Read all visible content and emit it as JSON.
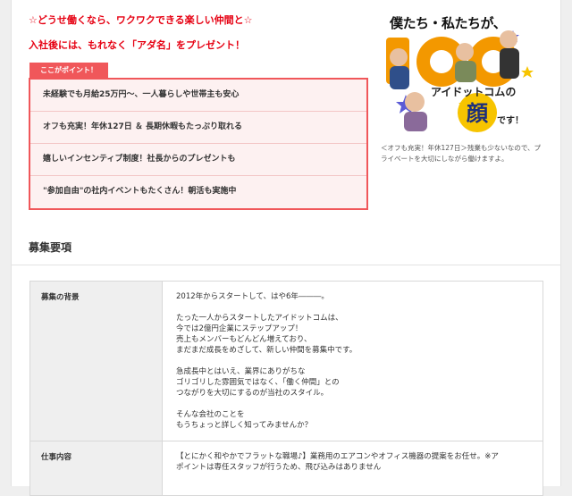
{
  "intro": {
    "line1": "☆どうせ働くなら、ワクワクできる楽しい仲間と☆",
    "line2": "入社後には、もれなく「アダ名」をプレゼント！"
  },
  "points": {
    "tag": "ここがポイント！",
    "items": [
      "未経験でも月給25万円～、一人暮らしや世帯主も安心",
      "オフも充実！年休127日 ＆ 長期休暇もたっぷり取れる",
      "嬉しいインセンティブ制度！社長からのプレゼントも",
      "\"参加自由\"の社内イベントもたくさん！朝活も実施中"
    ]
  },
  "hero": {
    "headline": "僕たち・私たちが、",
    "big_letters": "100",
    "company": "アイドットコムの",
    "face": "顔",
    "desu": "です！",
    "caption": "＜オフも充実！年休127日＞残業も少ないなので、プライベートを大切にしながら働けますよ。"
  },
  "recruit": {
    "title": "募集要項",
    "rows": [
      {
        "label": "募集の背景",
        "paragraphs": [
          [
            "2012年からスタートして、はや6年―――。"
          ],
          [
            "たった一人からスタートしたアイドットコムは、",
            "今では2億円企業にステップアップ！",
            "売上もメンバーもどんどん増えており、",
            "まだまだ成長をめざして、新しい仲間を募集中です。"
          ],
          [
            "急成長中とはいえ、業界にありがちな",
            "ゴリゴリした雰囲気ではなく、「働く仲間」との",
            "つながりを大切にするのが当社のスタイル。"
          ],
          [
            "そんな会社のことを",
            "もうちょっと詳しく知ってみませんか？"
          ]
        ]
      },
      {
        "label": "仕事内容",
        "paragraphs": [
          [
            "【とにかく和やかでフラットな職場♪】業務用のエアコンやオフィス機器の提案をお任せ。※ア",
            "ポイントは専任スタッフが行うため、飛び込みはありません"
          ]
        ]
      }
    ]
  },
  "colors": {
    "accent_red": "#e60012",
    "point_border": "#f0575a",
    "point_bg": "#fdf1f1",
    "table_header_bg": "#efefef",
    "hero_orange": "#f39800"
  }
}
